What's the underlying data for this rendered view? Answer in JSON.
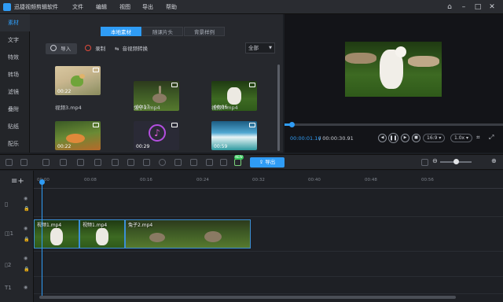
{
  "app": {
    "title": "迅捷视频剪辑软件",
    "menu": [
      "文件",
      "编辑",
      "视图",
      "导出",
      "帮助"
    ],
    "window_controls": [
      "home-icon",
      "minimize-icon",
      "maximize-icon",
      "close-icon"
    ]
  },
  "sidebar": {
    "items": [
      {
        "label": "素材",
        "active": true
      },
      {
        "label": "文字",
        "active": false
      },
      {
        "label": "特效",
        "active": false
      },
      {
        "label": "转场",
        "active": false
      },
      {
        "label": "滤镜",
        "active": false
      },
      {
        "label": "叠附",
        "active": false
      },
      {
        "label": "贴纸",
        "active": false
      },
      {
        "label": "配乐",
        "active": false
      }
    ]
  },
  "media": {
    "tabs": [
      {
        "label": "本地素材",
        "active": true
      },
      {
        "label": "随课片头",
        "active": false
      },
      {
        "label": "背景样例",
        "active": false
      }
    ],
    "import_label": "导入",
    "record_label": "录制",
    "convert_label": "音视频转换",
    "filter_value": "全部",
    "clips": [
      {
        "name": "视频3.mp4",
        "duration": "00:22",
        "thumb": "parrot"
      },
      {
        "name": "兔子2.mp4",
        "duration": "00:17",
        "thumb": "rabbit"
      },
      {
        "name": "视频1.mp4",
        "duration": "00:06",
        "thumb": "goat"
      },
      {
        "name": "",
        "duration": "00:22",
        "thumb": "cat"
      },
      {
        "name": "",
        "duration": "00:29",
        "thumb": "music"
      },
      {
        "name": "",
        "duration": "00:59",
        "thumb": "sea"
      }
    ]
  },
  "preview": {
    "current_time": "00:00:01.16",
    "total_time": "/ 00:00:30.91",
    "aspect": "16:9",
    "speed": "1.0x",
    "progress": 0.04
  },
  "toolbar": {
    "export_label": "导出",
    "new_badge": "NEW",
    "icons": [
      "undo-icon",
      "redo-icon",
      "delete-icon",
      "edit-icon",
      "cut-icon",
      "copy-icon",
      "crop-icon",
      "mosaic-icon",
      "freeze-icon",
      "timer-icon",
      "mic-icon",
      "screen-icon",
      "picture-icon",
      "color-icon",
      "gift-icon"
    ]
  },
  "timeline": {
    "ticks": [
      "00:00",
      "00:08",
      "00:16",
      "00:24",
      "00:32",
      "00:40",
      "00:48",
      "00:56"
    ],
    "clips": [
      {
        "label": "视频1.mp4",
        "thumb": "goat"
      },
      {
        "label": "视频1.mp4",
        "thumb": "goat"
      },
      {
        "label": "兔子2.mp4",
        "thumb": "rabbit"
      }
    ],
    "track_labels": [
      "1",
      "1",
      "2",
      "1"
    ]
  }
}
